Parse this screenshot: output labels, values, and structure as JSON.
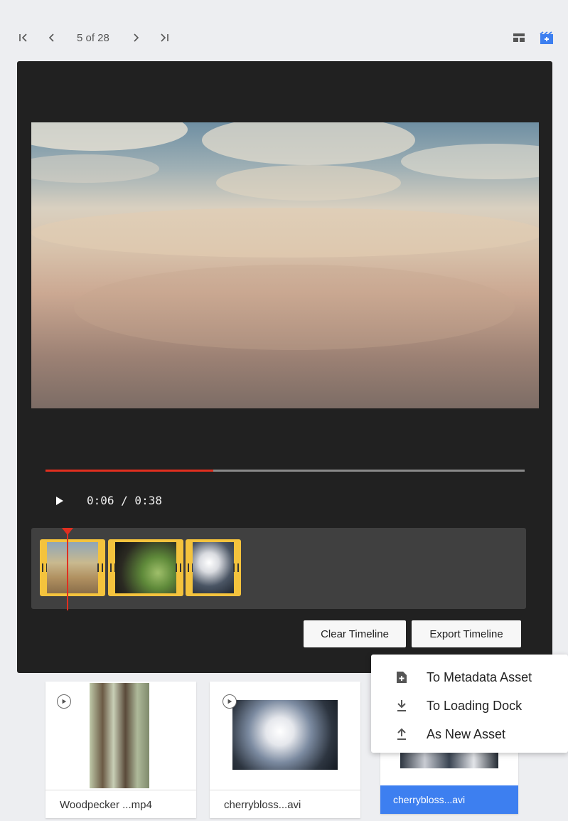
{
  "nav": {
    "first_icon": "first-page-icon",
    "prev_icon": "previous-icon",
    "page_indicator": "5 of 28",
    "next_icon": "next-icon",
    "last_icon": "last-page-icon",
    "view_icons": [
      "grid-view-icon",
      "timeline-view-icon"
    ]
  },
  "player": {
    "progress": 0.35,
    "time": "0:06 / 0:38",
    "timeline_clips": [
      {
        "name": "clip-woodpecker"
      },
      {
        "name": "clip-flowers"
      },
      {
        "name": "clip-cherryblossom"
      }
    ],
    "clear_label": "Clear Timeline",
    "export_label": "Export Timeline"
  },
  "export_menu": [
    {
      "icon": "file-plus-icon",
      "label": "To Metadata Asset"
    },
    {
      "icon": "download-icon",
      "label": "To Loading Dock"
    },
    {
      "icon": "upload-icon",
      "label": "As New Asset"
    }
  ],
  "assets": [
    {
      "label": "Woodpecker ...mp4",
      "selected": false
    },
    {
      "label": "cherrybloss...avi",
      "selected": false
    },
    {
      "label": "cherrybloss...avi",
      "selected": true
    }
  ],
  "colors": {
    "accent": "#3d7ff0",
    "progress": "#e12f1f",
    "clip": "#f4c33d",
    "player_bg": "#212121"
  }
}
